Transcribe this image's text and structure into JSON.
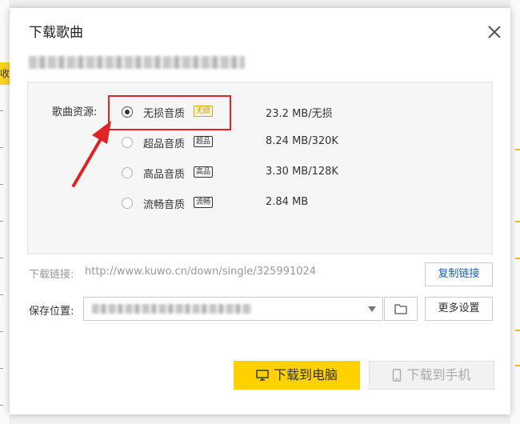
{
  "dialog": {
    "title": "下载歌曲"
  },
  "background": {
    "tab_label": "收"
  },
  "quality": {
    "label": "歌曲资源:",
    "options": [
      {
        "name": "无损音质",
        "badge": "无损",
        "size": "23.2  MB/无损",
        "selected": true
      },
      {
        "name": "超品音质",
        "badge": "超品",
        "size": "8.24 MB/320K",
        "selected": false
      },
      {
        "name": "高品音质",
        "badge": "高品",
        "size": "3.30 MB/128K",
        "selected": false
      },
      {
        "name": "流畅音质",
        "badge": "流畅",
        "size": "2.84 MB",
        "selected": false
      }
    ]
  },
  "download_link": {
    "label": "下载链接:",
    "url": "http://www.kuwo.cn/down/single/325991024",
    "copy_button": "复制链接"
  },
  "save": {
    "label": "保存位置:",
    "more_button": "更多设置"
  },
  "actions": {
    "download_pc": "下载到电脑",
    "download_phone": "下载到手机"
  },
  "colors": {
    "primary": "#ffd100",
    "highlight": "#e02424",
    "link": "#1a5fb4"
  }
}
